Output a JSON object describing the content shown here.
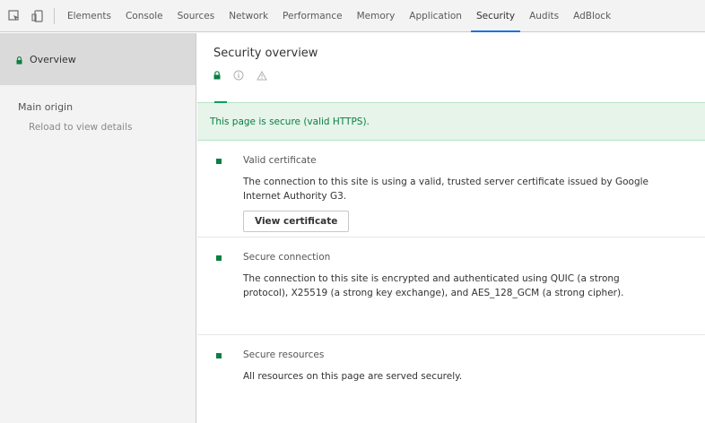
{
  "toolbar": {
    "tabs": [
      {
        "label": "Elements"
      },
      {
        "label": "Console"
      },
      {
        "label": "Sources"
      },
      {
        "label": "Network"
      },
      {
        "label": "Performance"
      },
      {
        "label": "Memory"
      },
      {
        "label": "Application"
      },
      {
        "label": "Security"
      },
      {
        "label": "Audits"
      },
      {
        "label": "AdBlock"
      }
    ],
    "active_tab": "Security"
  },
  "sidebar": {
    "overview_label": "Overview",
    "main_origin_label": "Main origin",
    "reload_hint": "Reload to view details"
  },
  "main": {
    "title": "Security overview",
    "summary": "This page is secure (valid HTTPS).",
    "cards": [
      {
        "title": "Valid certificate",
        "description": "The connection to this site is using a valid, trusted server certificate issued by Google Internet Authority G3.",
        "button": "View certificate"
      },
      {
        "title": "Secure connection",
        "description": "The connection to this site is encrypted and authenticated using QUIC (a strong protocol), X25519 (a strong key exchange), and AES_128_GCM (a strong cipher)."
      },
      {
        "title": "Secure resources",
        "description": "All resources on this page are served securely."
      }
    ]
  },
  "colors": {
    "secure_green": "#0b8043",
    "accent_blue": "#1a73e8",
    "summary_bg": "#e6f4ea"
  }
}
